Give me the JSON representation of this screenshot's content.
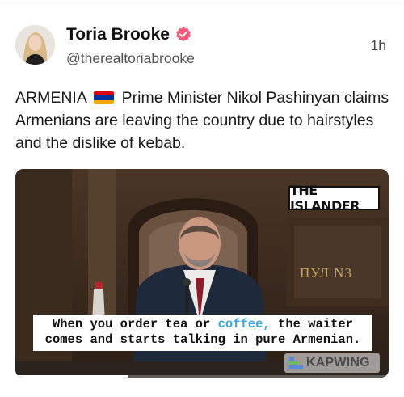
{
  "post": {
    "author": {
      "display_name": "Toria Brooke",
      "handle": "@therealtoriabrooke",
      "verified": true,
      "verified_color": "#f55a7a"
    },
    "timestamp": "1h",
    "text_before_flag": "ARMENIA",
    "flag_icon": "armenia-flag",
    "text_after_flag": "Prime Minister Nikol Pashinyan claims Armenians are leaving the country due to hairstyles and the dislike of kebab."
  },
  "video": {
    "badge": "THE ISLANDER",
    "sign_text": "ПУЛ N3",
    "caption_pre": "When you order tea or ",
    "caption_highlight": "coffee,",
    "caption_post": " the waiter\ncomes and starts talking in pure Armenian.",
    "highlight_color": "#3aa7e8",
    "watermark": "KAPWING",
    "progress": 0.3
  },
  "colors": {
    "flag": [
      "#d90012",
      "#0033a0",
      "#f2a800"
    ]
  }
}
